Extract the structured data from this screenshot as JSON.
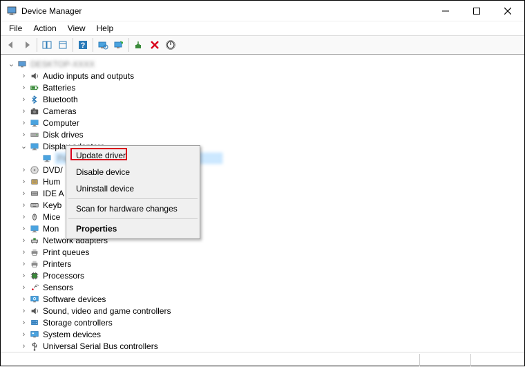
{
  "window": {
    "title": "Device Manager"
  },
  "menubar": {
    "items": [
      "File",
      "Action",
      "View",
      "Help"
    ]
  },
  "tree": {
    "root": "DESKTOP-XXXX",
    "nodes": [
      {
        "label": "Audio inputs and outputs",
        "icon": "speaker"
      },
      {
        "label": "Batteries",
        "icon": "battery"
      },
      {
        "label": "Bluetooth",
        "icon": "bluetooth"
      },
      {
        "label": "Cameras",
        "icon": "camera"
      },
      {
        "label": "Computer",
        "icon": "monitor"
      },
      {
        "label": "Disk drives",
        "icon": "disk"
      },
      {
        "label": "Display adapters",
        "icon": "monitor",
        "expanded": true,
        "children": [
          {
            "label": "Parallels Display Adapter (WDDM)",
            "icon": "monitor",
            "selected": true,
            "blurred": true
          }
        ]
      },
      {
        "label": "DVD/",
        "icon": "dvd",
        "truncated": true,
        "full": "DVD/CD-ROM drives"
      },
      {
        "label": "Hum",
        "icon": "hid",
        "truncated": true,
        "full": "Human Interface Devices"
      },
      {
        "label": "IDE A",
        "icon": "ide",
        "truncated": true,
        "full": "IDE ATA/ATAPI controllers"
      },
      {
        "label": "Keyb",
        "icon": "keyboard",
        "truncated": true,
        "full": "Keyboards"
      },
      {
        "label": "Mice",
        "icon": "mouse",
        "truncated": true,
        "full": "Mice and other pointing devices"
      },
      {
        "label": "Mon",
        "icon": "monitor",
        "truncated": true,
        "full": "Monitors"
      },
      {
        "label": "Network adapters",
        "icon": "network"
      },
      {
        "label": "Print queues",
        "icon": "printer"
      },
      {
        "label": "Printers",
        "icon": "printer"
      },
      {
        "label": "Processors",
        "icon": "cpu"
      },
      {
        "label": "Sensors",
        "icon": "sensor"
      },
      {
        "label": "Software devices",
        "icon": "software"
      },
      {
        "label": "Sound, video and game controllers",
        "icon": "sound"
      },
      {
        "label": "Storage controllers",
        "icon": "storage"
      },
      {
        "label": "System devices",
        "icon": "system"
      },
      {
        "label": "Universal Serial Bus controllers",
        "icon": "usb"
      }
    ]
  },
  "context_menu": {
    "items": [
      {
        "label": "Update driver",
        "highlighted": true
      },
      {
        "label": "Disable device"
      },
      {
        "label": "Uninstall device"
      },
      {
        "sep": true
      },
      {
        "label": "Scan for hardware changes"
      },
      {
        "sep": true
      },
      {
        "label": "Properties",
        "bold": true
      }
    ]
  }
}
